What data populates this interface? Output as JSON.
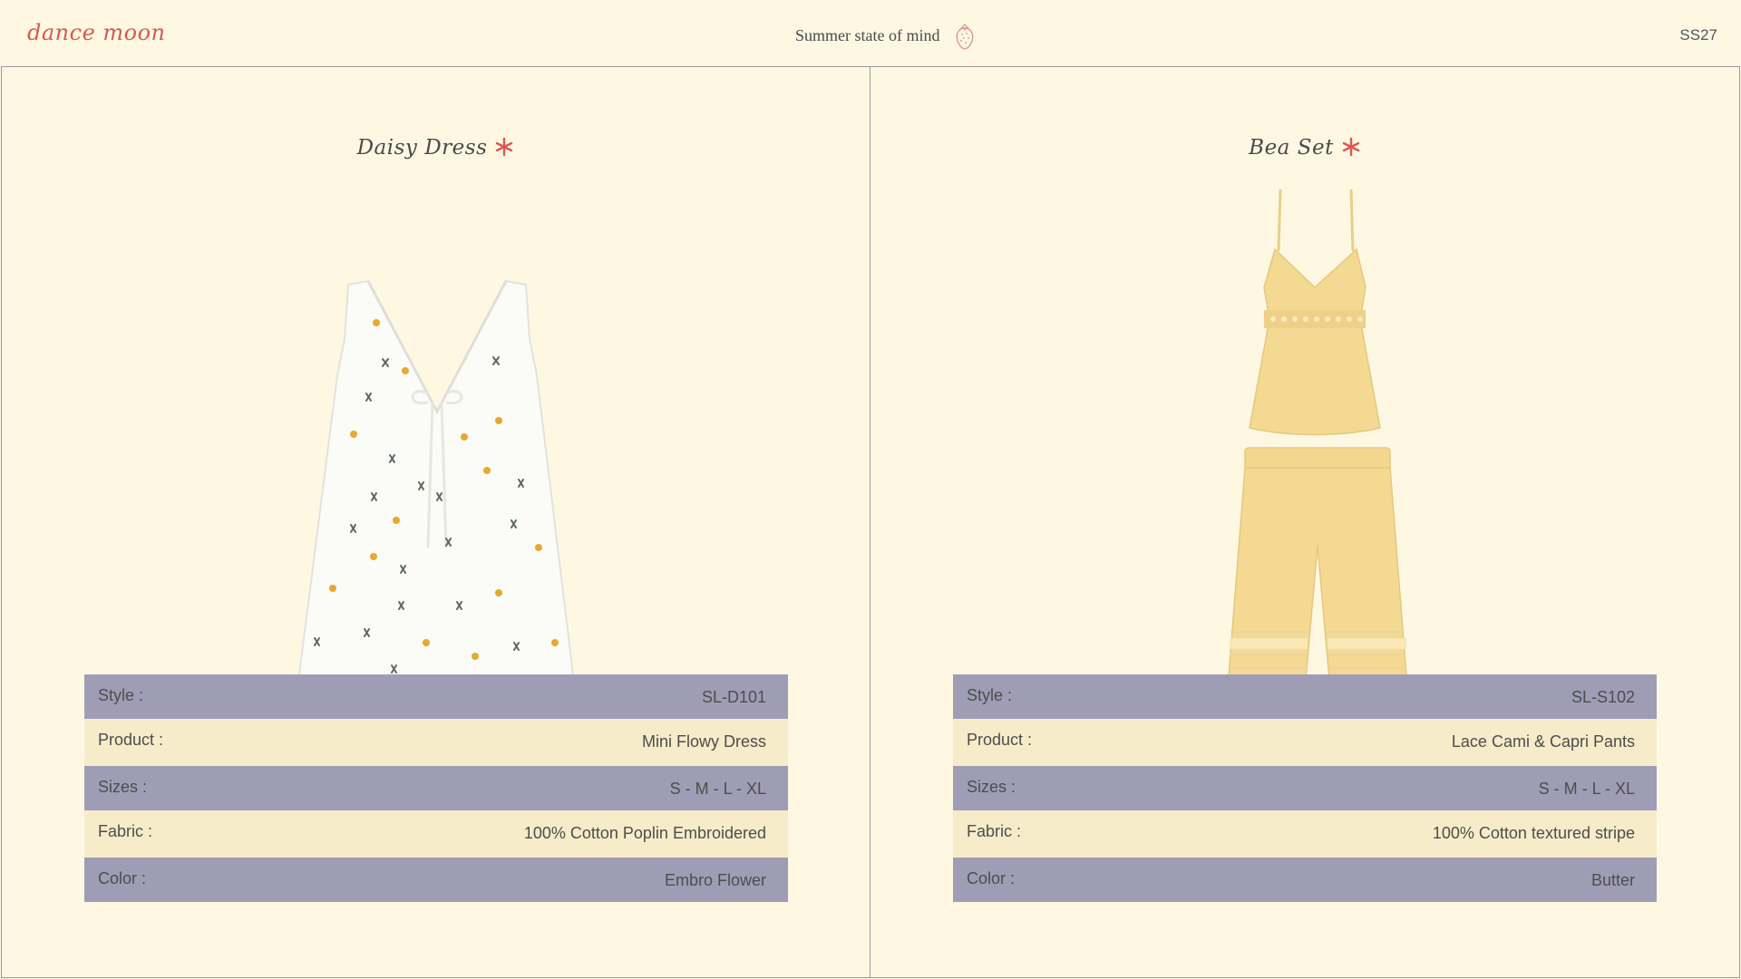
{
  "header": {
    "brand": "dance moon",
    "tagline": "Summer state of mind",
    "season": "SS27"
  },
  "products": [
    {
      "title": "Daisy Dress",
      "specs": [
        {
          "label": "Style :",
          "value": "SL-D101"
        },
        {
          "label": "Product :",
          "value": "Mini Flowy Dress"
        },
        {
          "label": "Sizes :",
          "value": "S - M - L - XL"
        },
        {
          "label": "Fabric :",
          "value": "100% Cotton Poplin Embroidered"
        },
        {
          "label": "Color :",
          "value": "Embro Flower"
        }
      ]
    },
    {
      "title": "Bea Set",
      "specs": [
        {
          "label": "Style :",
          "value": "SL-S102"
        },
        {
          "label": "Product :",
          "value": "Lace Cami & Capri Pants"
        },
        {
          "label": "Sizes :",
          "value": "S - M - L - XL"
        },
        {
          "label": "Fabric :",
          "value": "100% Cotton textured stripe"
        },
        {
          "label": "Color :",
          "value": "Butter"
        }
      ]
    }
  ],
  "colors": {
    "background": "#fef8e3",
    "accent": "#d9584f",
    "row_dark": "#9f9db5",
    "row_light": "#f7ecc9",
    "butter": "#f4d993"
  },
  "icons": {
    "tagline_icon": "strawberry-icon",
    "title_icon": "star-icon"
  }
}
